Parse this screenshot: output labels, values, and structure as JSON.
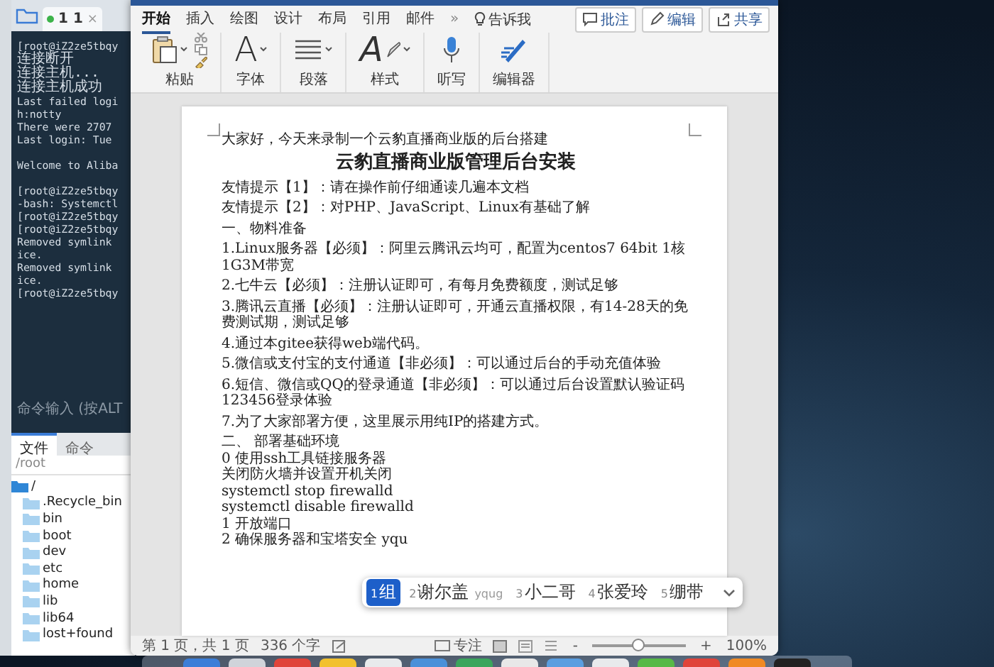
{
  "terminal_window": {
    "tab": {
      "label": "1 1",
      "close": "×"
    },
    "blocks": [
      [
        "[root@iZ2ze5tbqy",
        "连接断开",
        "连接主机...",
        "连接主机成功",
        "Last failed logi",
        "h:notty",
        "There were 2707",
        "Last login: Tue"
      ],
      [
        "Welcome to Aliba"
      ],
      [
        "[root@iZ2ze5tbqy",
        "-bash: Systemctl",
        "[root@iZ2ze5tbqy",
        "[root@iZ2ze5tbqy",
        "Removed symlink",
        "ice.",
        "Removed symlink",
        "ice.",
        "[root@iZ2ze5tbqy"
      ]
    ],
    "command_input": {
      "placeholder": "命令输入 (按ALT"
    },
    "panel_tabs": [
      {
        "label": "文件",
        "selected": true
      },
      {
        "label": "命令",
        "selected": false
      }
    ],
    "path": "/root",
    "file_tree": [
      {
        "name": "/",
        "children": [
          {
            "name": ".Recycle_bin"
          },
          {
            "name": "bin"
          },
          {
            "name": "boot"
          },
          {
            "name": "dev"
          },
          {
            "name": "etc"
          },
          {
            "name": "home"
          },
          {
            "name": "lib"
          },
          {
            "name": "lib64"
          },
          {
            "name": "lost+found"
          }
        ]
      }
    ]
  },
  "word_window": {
    "ribbon_tabs": [
      {
        "label": "开始",
        "selected": true
      },
      {
        "label": "插入",
        "selected": false
      },
      {
        "label": "绘图",
        "selected": false
      },
      {
        "label": "设计",
        "selected": false
      },
      {
        "label": "布局",
        "selected": false
      },
      {
        "label": "引用",
        "selected": false
      },
      {
        "label": "邮件",
        "selected": false
      }
    ],
    "overflow": "»",
    "tell_me": "告诉我",
    "actions": [
      {
        "label": "批注",
        "kind": "comment"
      },
      {
        "label": "编辑",
        "kind": "edit"
      },
      {
        "label": "共享",
        "kind": "share"
      }
    ],
    "tool_groups": [
      {
        "label": "粘贴",
        "kind": "paste"
      },
      {
        "label": "字体",
        "kind": "font",
        "glyph": "A"
      },
      {
        "label": "段落",
        "kind": "paragraph"
      },
      {
        "label": "样式",
        "kind": "styles",
        "glyph": "A"
      },
      {
        "label": "听写",
        "kind": "dictate"
      },
      {
        "label": "编辑器",
        "kind": "editor"
      }
    ],
    "document": {
      "paragraphs": [
        {
          "kind": "intro",
          "text": "大家好，今天来录制一个云豹直播商业版的后台搭建"
        },
        {
          "kind": "heading",
          "text": "云豹直播商业版管理后台安装"
        },
        {
          "kind": "para",
          "text": "友情提示【1】：请在操作前仔细通读几遍本文档"
        },
        {
          "kind": "para",
          "text": "友情提示【2】：对PHP、JavaScript、Linux有基础了解"
        },
        {
          "kind": "para",
          "text": "一、物料准备"
        },
        {
          "kind": "para",
          "text": "1.Linux服务器【必须】：阿里云腾讯云均可，配置为centos7 64bit 1核1G3M带宽"
        },
        {
          "kind": "para",
          "text": "2.七牛云【必须】：注册认证即可，有每月免费额度，测试足够"
        },
        {
          "kind": "para",
          "text": "3.腾讯云直播【必须】：注册认证即可，开通云直播权限，有14-28天的免费测试期，测试足够"
        },
        {
          "kind": "para",
          "text": "4.通过本gitee获得web端代码。"
        },
        {
          "kind": "para",
          "text": "5.微信或支付宝的支付通道【非必须】：可以通过后台的手动充值体验"
        },
        {
          "kind": "para",
          "text": "6.短信、微信或QQ的登录通道【非必须】：可以通过后台设置默认验证码123456登录体验"
        },
        {
          "kind": "para",
          "text": "7.为了大家部署方便，这里展示用纯IP的搭建方式。"
        },
        {
          "kind": "line",
          "text": "二、 部署基础环境"
        },
        {
          "kind": "line",
          "text": "0 使用ssh工具链接服务器"
        },
        {
          "kind": "line",
          "text": "关闭防火墙并设置开机关闭"
        },
        {
          "kind": "line",
          "text": "systemctl stop firewalld"
        },
        {
          "kind": "line",
          "text": "systemctl disable firewalld"
        },
        {
          "kind": "line",
          "text": "1   开放端口"
        },
        {
          "kind": "line",
          "text": "2   确保服务器和宝塔安全 yqu"
        }
      ]
    },
    "status_bar": {
      "page": "第 1 页，共 1 页",
      "word_count": "336 个字",
      "focus": "专注",
      "zoom_out": "-",
      "zoom_in": "+",
      "zoom": {
        "level": 0.5,
        "reading": "100%"
      }
    }
  },
  "ime_candidates": [
    {
      "number": "1",
      "text": "组",
      "selected": true
    },
    {
      "number": "2",
      "text": "谢尔盖",
      "hint": "yqug",
      "selected": false
    },
    {
      "number": "3",
      "text": "小二哥",
      "selected": false
    },
    {
      "number": "4",
      "text": "张爱玲",
      "selected": false
    },
    {
      "number": "5",
      "text": "绷带",
      "selected": false
    }
  ]
}
